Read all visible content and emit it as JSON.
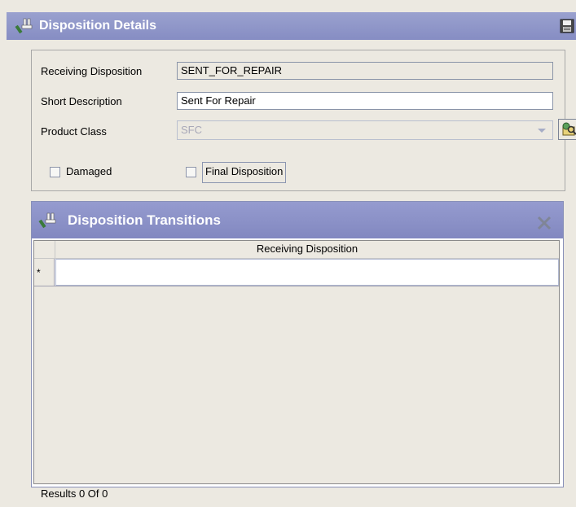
{
  "window": {
    "title": "Disposition Details"
  },
  "form": {
    "receiving_disposition_label": "Receiving Disposition",
    "receiving_disposition_value": "SENT_FOR_REPAIR",
    "short_description_label": "Short Description",
    "short_description_value": "Sent For Repair",
    "product_class_label": "Product Class",
    "product_class_value": "SFC",
    "damaged_label": "Damaged",
    "damaged_checked": false,
    "final_disposition_label": "Final Disposition",
    "final_disposition_checked": false
  },
  "transitions": {
    "title": "Disposition Transitions",
    "columns": [
      "Receiving Disposition"
    ],
    "new_row_marker": "*",
    "rows": []
  },
  "footer": {
    "results_text": "Results 0  Of 0"
  },
  "colors": {
    "titlebar": "#868dc3",
    "panel_bg": "#ece9e1"
  }
}
